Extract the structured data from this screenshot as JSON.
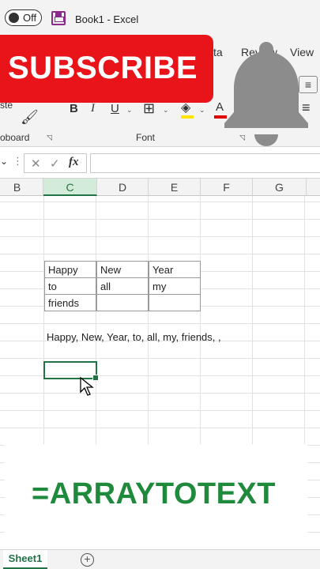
{
  "titlebar": {
    "autosave_label": "Off",
    "doc_title": "Book1  -  Excel"
  },
  "ribbon": {
    "tabs": [
      "ta",
      "Review",
      "View"
    ],
    "groups": {
      "clipboard": "oboard",
      "font": "Font"
    },
    "paste_label": "ste",
    "bold": "B",
    "italic": "I",
    "underline": "U",
    "font_color_letter": "A",
    "fill_color": "#ffe500",
    "font_color": "#e00000"
  },
  "formula_bar": {
    "cancel": "✕",
    "enter": "✓",
    "fx": "fx",
    "value": ""
  },
  "grid": {
    "columns": [
      "B",
      "C",
      "D",
      "E",
      "F",
      "G"
    ],
    "selected_column": "C",
    "table": [
      [
        "Happy",
        "New",
        "Year"
      ],
      [
        "to",
        "all",
        "my"
      ],
      [
        "friends",
        "",
        ""
      ]
    ],
    "result_text": "Happy, New, Year, to, all, my, friends, ,"
  },
  "sheets": {
    "active": "Sheet1",
    "add": "+"
  },
  "overlay": {
    "subscribe": "SUBSCRIBE",
    "banner": "=ARRAYTOTEXT"
  }
}
